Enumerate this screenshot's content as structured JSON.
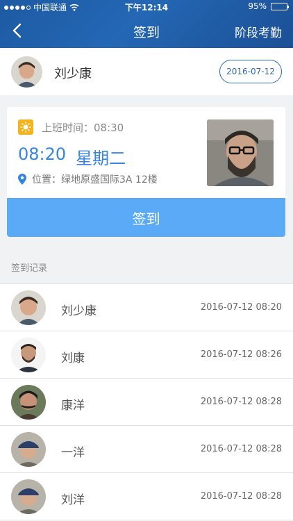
{
  "status_bar": {
    "carrier": "中国联通",
    "time": "下午12:14",
    "battery": "95%",
    "battery_level": 0.95
  },
  "nav": {
    "title": "签到",
    "right_label": "阶段考勤"
  },
  "user": {
    "name": "刘少康",
    "date": "2016-07-12"
  },
  "checkin": {
    "work_time_label": "上班时间：08:30",
    "current_time": "08:20",
    "weekday": "星期二",
    "location": "位置：绿地原盛国际3A 12楼",
    "button_label": "签到"
  },
  "records_title": "签到记录",
  "records": [
    {
      "name": "刘少康",
      "time": "2016-07-12  08:20"
    },
    {
      "name": "刘康",
      "time": "2016-07-12  08:26"
    },
    {
      "name": "康洋",
      "time": "2016-07-12  08:28"
    },
    {
      "name": "一洋",
      "time": "2016-07-12  08:28"
    },
    {
      "name": "刘洋",
      "time": "2016-07-12  08:28"
    }
  ],
  "colors": {
    "nav_bg": "#1d5aa3",
    "accent": "#3784df",
    "button": "#5baaf8",
    "sun": "#f3b321"
  }
}
